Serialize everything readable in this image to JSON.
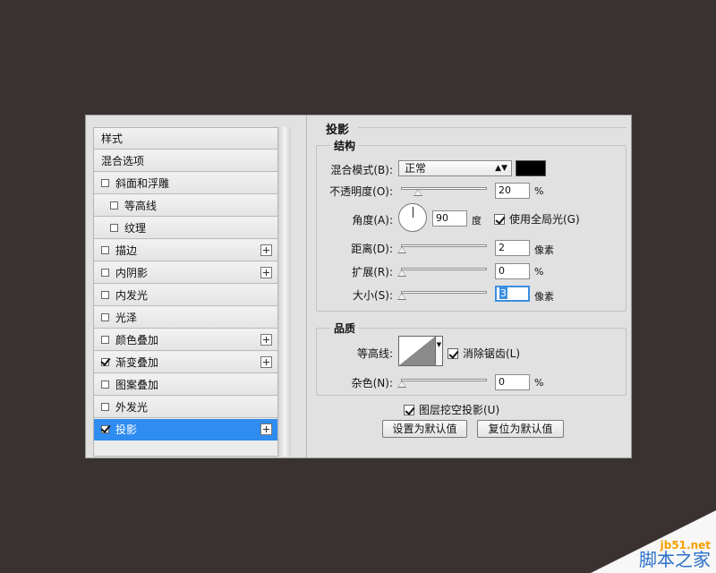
{
  "style_list": {
    "header": "样式",
    "items": [
      {
        "label": "混合选项",
        "checkbox": false,
        "checked": false,
        "indent": false,
        "plus": false,
        "active": false
      },
      {
        "label": "斜面和浮雕",
        "checkbox": true,
        "checked": false,
        "indent": false,
        "plus": false,
        "active": false
      },
      {
        "label": "等高线",
        "checkbox": true,
        "checked": false,
        "indent": true,
        "plus": false,
        "active": false
      },
      {
        "label": "纹理",
        "checkbox": true,
        "checked": false,
        "indent": true,
        "plus": false,
        "active": false
      },
      {
        "label": "描边",
        "checkbox": true,
        "checked": false,
        "indent": false,
        "plus": true,
        "active": false
      },
      {
        "label": "内阴影",
        "checkbox": true,
        "checked": false,
        "indent": false,
        "plus": true,
        "active": false
      },
      {
        "label": "内发光",
        "checkbox": true,
        "checked": false,
        "indent": false,
        "plus": false,
        "active": false
      },
      {
        "label": "光泽",
        "checkbox": true,
        "checked": false,
        "indent": false,
        "plus": false,
        "active": false
      },
      {
        "label": "颜色叠加",
        "checkbox": true,
        "checked": false,
        "indent": false,
        "plus": true,
        "active": false
      },
      {
        "label": "渐变叠加",
        "checkbox": true,
        "checked": true,
        "indent": false,
        "plus": true,
        "active": false
      },
      {
        "label": "图案叠加",
        "checkbox": true,
        "checked": false,
        "indent": false,
        "plus": false,
        "active": false
      },
      {
        "label": "外发光",
        "checkbox": true,
        "checked": false,
        "indent": false,
        "plus": false,
        "active": false
      },
      {
        "label": "投影",
        "checkbox": true,
        "checked": true,
        "indent": false,
        "plus": true,
        "active": true
      }
    ]
  },
  "panel": {
    "title": "投影",
    "structure": {
      "label": "结构",
      "blend_mode_label": "混合模式(B):",
      "blend_mode_value": "正常",
      "shadow_color": "#000000",
      "opacity_label": "不透明度(O):",
      "opacity_value": "20",
      "opacity_unit": "%",
      "opacity_level": 0.2,
      "angle_label": "角度(A):",
      "angle_value": "90",
      "angle_unit": "度",
      "global_light_label": "使用全局光(G)",
      "global_light_checked": true,
      "distance_label": "距离(D):",
      "distance_value": "2",
      "distance_unit": "像素",
      "spread_label": "扩展(R):",
      "spread_value": "0",
      "spread_unit": "%",
      "size_label": "大小(S):",
      "size_value": "3",
      "size_unit": "像素"
    },
    "quality": {
      "label": "品质",
      "contour_label": "等高线:",
      "anti_alias_label": "消除锯齿(L)",
      "anti_alias_checked": true,
      "noise_label": "杂色(N):",
      "noise_value": "0",
      "noise_unit": "%"
    },
    "knockout_label": "图层挖空投影(U)",
    "knockout_checked": true,
    "make_default": "设置为默认值",
    "reset_default": "复位为默认值"
  },
  "watermark": {
    "url": "jb51.net",
    "name": "脚本之家"
  }
}
